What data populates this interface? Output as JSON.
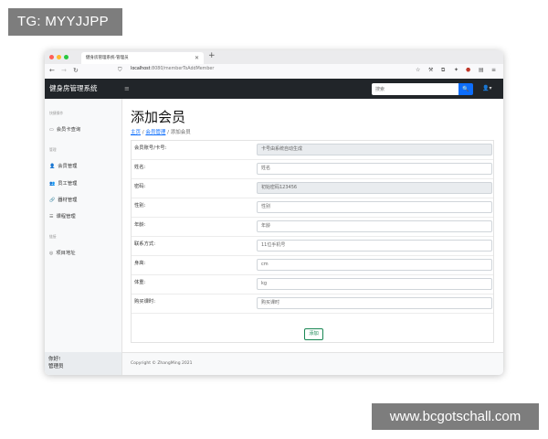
{
  "overlay": {
    "top_left_tag": "TG: MYYJJPP",
    "bottom_right_tag": "www.bcgotschall.com"
  },
  "browser": {
    "tab_title": "健身房管理系统-管理员",
    "address": {
      "host": "localhost",
      "path": ":8080/memberToAddMember"
    },
    "traffic_colors": [
      "#ff5f57",
      "#febc2e",
      "#28c840"
    ]
  },
  "navbar": {
    "brand": "健身房管理系统",
    "menu_icon": "≡",
    "search_placeholder": "搜索",
    "search_icon": "🔍",
    "user_icon": "👤▾"
  },
  "sidebar": {
    "sections": [
      {
        "heading": "快捷操作",
        "items": [
          {
            "icon": "card-icon",
            "label": "会员卡查询"
          }
        ]
      },
      {
        "heading": "管理",
        "items": [
          {
            "icon": "person-icon",
            "label": "会员管理"
          },
          {
            "icon": "people-icon",
            "label": "员工管理"
          },
          {
            "icon": "equipment-icon",
            "label": "器材管理"
          },
          {
            "icon": "list-icon",
            "label": "课程管理"
          }
        ]
      },
      {
        "heading": "链接",
        "items": [
          {
            "icon": "github-icon",
            "label": "项目地址"
          }
        ]
      }
    ],
    "footer": {
      "greeting": "你好!",
      "role": "管理员"
    }
  },
  "main": {
    "title": "添加会员",
    "breadcrumb": {
      "home": "主页",
      "section": "会员管理",
      "current": "添加会员"
    },
    "form": {
      "fields": [
        {
          "label": "会员账号/卡号:",
          "placeholder": "卡号由系统自动生成",
          "readonly": true
        },
        {
          "label": "姓名:",
          "placeholder": "姓名"
        },
        {
          "label": "密码:",
          "placeholder": "初始密码123456",
          "readonly": true
        },
        {
          "label": "性别:",
          "placeholder": "性别"
        },
        {
          "label": "年龄:",
          "placeholder": "年龄"
        },
        {
          "label": "联系方式:",
          "placeholder": "11位手机号"
        },
        {
          "label": "身高:",
          "placeholder": "cm"
        },
        {
          "label": "体重:",
          "placeholder": "kg"
        },
        {
          "label": "购买课时:",
          "placeholder": "购买课时"
        }
      ],
      "submit_label": "添加"
    }
  },
  "footer": {
    "copyright": "Copyright © ZhangMing 2021"
  }
}
